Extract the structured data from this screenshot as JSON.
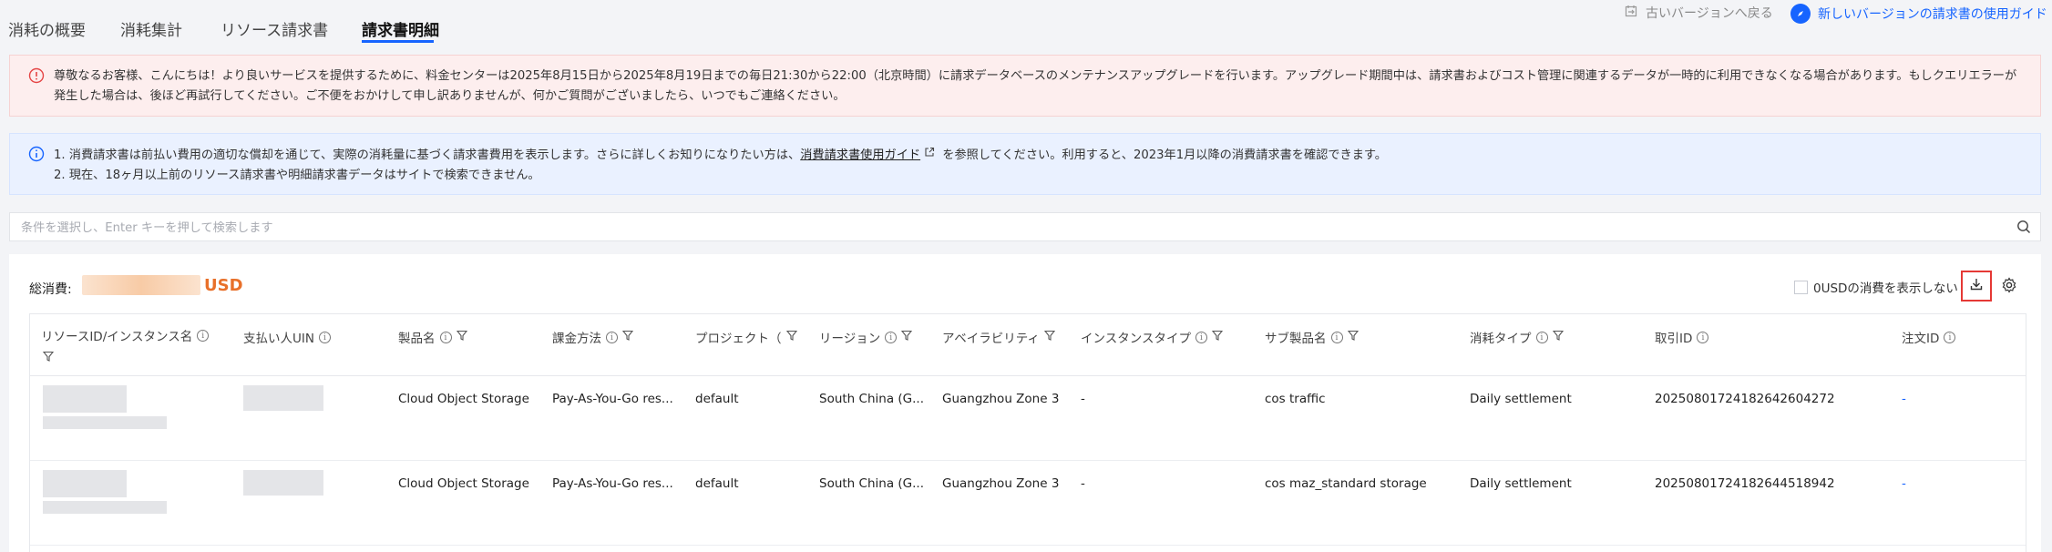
{
  "tabs": [
    {
      "label": "消耗の概要",
      "active": false
    },
    {
      "label": "消耗集計",
      "active": false
    },
    {
      "label": "リソース請求書",
      "active": false
    },
    {
      "label": "請求書明細",
      "active": true
    }
  ],
  "top_links": {
    "old_version": "古いバージョンへ戻る",
    "new_guide": "新しいバージョンの請求書の使用ガイド"
  },
  "alert_maintenance": {
    "text": "尊敬なるお客様、こんにちは！より良いサービスを提供するために、料金センターは2025年8月15日から2025年8月19日までの毎日21:30から22:00（北京時間）に請求データベースのメンテナンスアップグレードを行います。アップグレード期間中は、請求書およびコスト管理に関連するデータが一時的に利用できなくなる場合があります。もしクエリエラーが発生した場合は、後ほど再試行してください。ご不便をおかけして申し訳ありませんが、何かご質問がございましたら、いつでもご連絡ください。"
  },
  "alert_info": {
    "line1_prefix": "1. 消費請求書は前払い費用の適切な償却を通じて、実際の消耗量に基づく請求書費用を表示します。さらに詳しくお知りになりたい方は、",
    "line1_link": "消費請求書使用ガイド",
    "line1_suffix": " を参照してください。利用すると、2023年1月以降の消費請求書を確認できます。",
    "line2": "2. 現在、18ヶ月以上前のリソース請求書や明細請求書データはサイトで検索できません。"
  },
  "search": {
    "placeholder": "条件を選択し、Enter キーを押して検索します",
    "value": ""
  },
  "summary": {
    "total_label": "総消費:",
    "currency": "USD",
    "hide_zero_label": "0USDの消費を表示しない",
    "hide_zero_checked": false
  },
  "table": {
    "columns": [
      {
        "label": "リソースID/インスタンス名",
        "info": true,
        "filter": true
      },
      {
        "label": "支払い人UIN",
        "info": true,
        "filter": false
      },
      {
        "label": "製品名",
        "info": true,
        "filter": true
      },
      {
        "label": "課金方法",
        "info": true,
        "filter": true
      },
      {
        "label": "プロジェクト（",
        "info": false,
        "filter": true
      },
      {
        "label": "リージョン",
        "info": true,
        "filter": true
      },
      {
        "label": "アベイラビリティ",
        "info": false,
        "filter": true
      },
      {
        "label": "インスタンスタイプ",
        "info": true,
        "filter": true
      },
      {
        "label": "サブ製品名",
        "info": true,
        "filter": true
      },
      {
        "label": "消耗タイプ",
        "info": true,
        "filter": true
      },
      {
        "label": "取引ID",
        "info": true,
        "filter": false
      },
      {
        "label": "注文ID",
        "info": true,
        "filter": false
      }
    ],
    "rows": [
      {
        "product": "Cloud Object Storage",
        "billing": "Pay-As-You-Go res...",
        "project": "default",
        "region": "South China (G...",
        "zone": "Guangzhou Zone 3",
        "instance_type": "-",
        "sub_product": "cos traffic",
        "consumption_type": "Daily settlement",
        "transaction_id": "20250801724182642604272",
        "order_id": "-"
      },
      {
        "product": "Cloud Object Storage",
        "billing": "Pay-As-You-Go res...",
        "project": "default",
        "region": "South China (G...",
        "zone": "Guangzhou Zone 3",
        "instance_type": "-",
        "sub_product": "cos maz_standard storage",
        "consumption_type": "Daily settlement",
        "transaction_id": "20250801724182644518942",
        "order_id": "-"
      }
    ]
  },
  "colors": {
    "accent": "#1664ff",
    "alert_red_bg": "#fdeeee",
    "alert_blue_bg": "#eaf1ff",
    "currency": "#e8702a",
    "highlight_border": "#e53935"
  }
}
